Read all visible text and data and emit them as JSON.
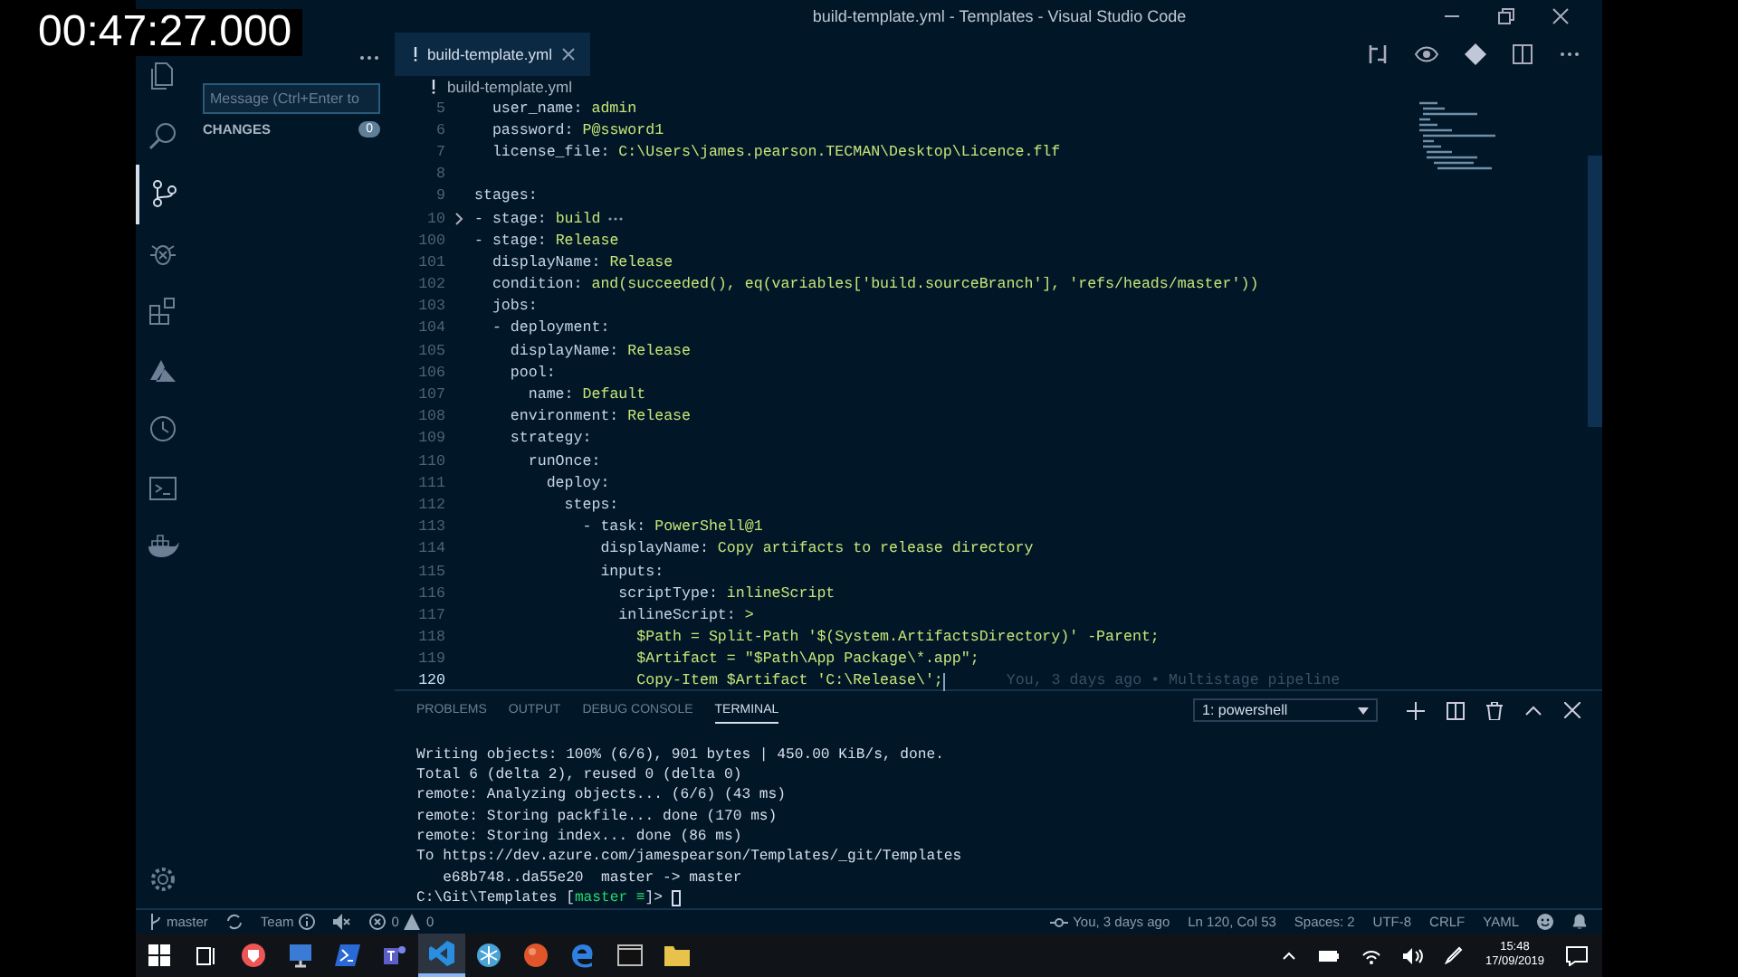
{
  "timestamp": "00:47:27.000",
  "window": {
    "title": "build-template.yml - Templates - Visual Studio Code"
  },
  "activity_bar": {
    "items": [
      {
        "kind": "files",
        "selected": false
      },
      {
        "kind": "search",
        "selected": false
      },
      {
        "kind": "source-control",
        "selected": true
      },
      {
        "kind": "debug",
        "selected": false
      },
      {
        "kind": "extensions",
        "selected": false
      },
      {
        "kind": "azure",
        "selected": false
      },
      {
        "kind": "history",
        "selected": false
      },
      {
        "kind": "shell",
        "selected": false
      },
      {
        "kind": "docker",
        "selected": false
      }
    ]
  },
  "sidebar": {
    "message_placeholder": "Message (Ctrl+Enter to",
    "changes_label": "CHANGES",
    "changes_count": "0"
  },
  "tabs": [
    {
      "label": "build-template.yml",
      "selected": true
    }
  ],
  "breadcrumb": "build-template.yml",
  "code": {
    "lines": [
      {
        "number": "5",
        "key": "  user_name:",
        "value": " admin",
        "current": false,
        "folded": false
      },
      {
        "number": "6",
        "key": "  password:",
        "value": " P@ssword1",
        "current": false,
        "folded": false
      },
      {
        "number": "7",
        "key": "  license_file:",
        "value": " C:\\Users\\james.pearson.TECMAN\\Desktop\\Licence.flf",
        "current": false,
        "folded": false
      },
      {
        "number": "8",
        "current": false,
        "folded": false
      },
      {
        "number": "9",
        "key": "stages:",
        "current": false,
        "folded": false
      },
      {
        "number": "10",
        "key": "- stage:",
        "value": " build",
        "current": false,
        "folded": true
      },
      {
        "number": "100",
        "key": "- stage:",
        "value": " Release",
        "current": false,
        "folded": false
      },
      {
        "number": "101",
        "key": "  displayName:",
        "value": " Release",
        "current": false,
        "folded": false
      },
      {
        "number": "102",
        "key": "  condition:",
        "value": " and(succeeded(), eq(variables['build.sourceBranch'], 'refs/heads/master'))",
        "current": false,
        "folded": false
      },
      {
        "number": "103",
        "key": "  jobs:",
        "current": false,
        "folded": false
      },
      {
        "number": "104",
        "key": "  - deployment:",
        "current": false,
        "folded": false
      },
      {
        "number": "105",
        "key": "    displayName:",
        "value": " Release",
        "current": false,
        "folded": false
      },
      {
        "number": "106",
        "key": "    pool:",
        "current": false,
        "folded": false
      },
      {
        "number": "107",
        "key": "      name:",
        "value": " Default",
        "current": false,
        "folded": false
      },
      {
        "number": "108",
        "key": "    environment:",
        "value": " Release",
        "current": false,
        "folded": false
      },
      {
        "number": "109",
        "key": "    strategy:",
        "current": false,
        "folded": false
      },
      {
        "number": "110",
        "key": "      runOnce:",
        "current": false,
        "folded": false
      },
      {
        "number": "111",
        "key": "        deploy:",
        "current": false,
        "folded": false
      },
      {
        "number": "112",
        "key": "          steps:",
        "current": false,
        "folded": false
      },
      {
        "number": "113",
        "key": "            - task:",
        "value": " PowerShell@1",
        "current": false,
        "folded": false
      },
      {
        "number": "114",
        "key": "              displayName:",
        "value": " Copy artifacts to release directory",
        "current": false,
        "folded": false
      },
      {
        "number": "115",
        "key": "              inputs:",
        "current": false,
        "folded": false
      },
      {
        "number": "116",
        "key": "                scriptType:",
        "value": " inlineScript",
        "current": false,
        "folded": false
      },
      {
        "number": "117",
        "key": "                inlineScript:",
        "value": " >",
        "current": false,
        "folded": false
      },
      {
        "number": "118",
        "value": "                  $Path = Split-Path '$(System.ArtifactsDirectory)' -Parent;",
        "current": false,
        "folded": false
      },
      {
        "number": "119",
        "value": "                  $Artifact = \"$Path\\App Package\\*.app\";",
        "current": false,
        "folded": false
      },
      {
        "number": "120",
        "value": "                  Copy-Item $Artifact 'C:\\Release\\';",
        "current": true,
        "folded": false,
        "blame": "You, 3 days ago • Multistage pipeline"
      }
    ]
  },
  "panel": {
    "tabs": [
      {
        "label": "PROBLEMS",
        "selected": false
      },
      {
        "label": "OUTPUT",
        "selected": false
      },
      {
        "label": "DEBUG CONSOLE",
        "selected": false
      },
      {
        "label": "TERMINAL",
        "selected": true
      }
    ],
    "terminal_select": "1: powershell",
    "terminal_lines": [
      "Writing objects: 100% (6/6), 901 bytes | 450.00 KiB/s, done.",
      "Total 6 (delta 2), reused 0 (delta 0)",
      "remote: Analyzing objects... (6/6) (43 ms)",
      "remote: Storing packfile... done (170 ms)",
      "remote: Storing index... done (86 ms)",
      "To https://dev.azure.com/jamespearson/Templates/_git/Templates",
      "   e68b748..da55e20  master -> master"
    ],
    "prompt": {
      "start": "C:\\Git\\Templates [",
      "branch": "master ≡",
      "end": "]> "
    }
  },
  "status_bar": {
    "branch": "master",
    "team": "Team",
    "errors": "0",
    "warnings": "0",
    "blame": "You, 3 days ago",
    "position": "Ln 120, Col 53",
    "indentation": "Spaces: 2",
    "encoding": "UTF-8",
    "eol": "CRLF",
    "language": "YAML"
  },
  "taskbar": {
    "apps": [
      {
        "kind": "shield",
        "selected": false
      },
      {
        "kind": "monitor",
        "selected": false
      },
      {
        "kind": "powershell",
        "selected": false
      },
      {
        "kind": "teams",
        "selected": false
      },
      {
        "kind": "vscode",
        "selected": true
      },
      {
        "kind": "snowflake",
        "selected": false
      },
      {
        "kind": "orange",
        "selected": false
      },
      {
        "kind": "edge",
        "selected": false
      },
      {
        "kind": "console",
        "selected": false
      },
      {
        "kind": "folder",
        "selected": false
      }
    ],
    "time": "15:48",
    "date": "17/09/2019"
  }
}
